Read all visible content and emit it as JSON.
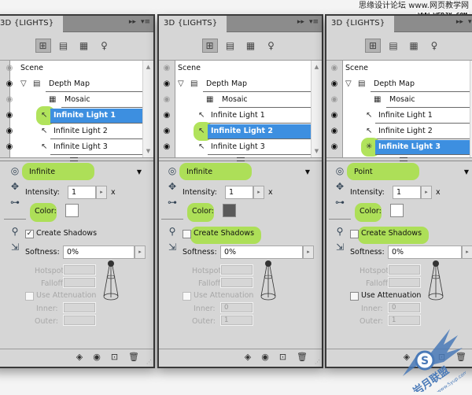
{
  "watermarks": {
    "top_line1": "思缘设计论坛 www.网页教学网",
    "top_line2": "WWW.WEBJX.COM",
    "bottom_text": "岩月联盟",
    "bottom_url": "www.5yup.com"
  },
  "panel_common": {
    "tab_title": "3D {LIGHTS}",
    "tab_controls": [
      "collapse-icon",
      "panel-menu-icon"
    ],
    "toolbar_buttons": [
      {
        "icon": "scene-filter-icon",
        "active": true
      },
      {
        "icon": "mesh-filter-icon",
        "active": false
      },
      {
        "icon": "material-filter-icon",
        "active": false
      },
      {
        "icon": "light-filter-icon",
        "active": false
      }
    ],
    "labels": {
      "intensity": "Intensity:",
      "multiply": "x",
      "color": "Color:",
      "create_shadows": "Create Shadows",
      "softness": "Softness:",
      "hotspot": "Hotspot:",
      "falloff": "Falloff:",
      "use_attenuation": "Use Attenuation",
      "inner": "Inner:",
      "outer": "Outer:"
    },
    "side_tools": [
      "rotate-light-icon",
      "pan-light-icon",
      "slide-light-icon",
      "point-at-origin-icon",
      "move-to-view-icon"
    ],
    "footer_icons": [
      "toggle-ground-plane-icon",
      "toggle-lights-icon",
      "new-light-icon",
      "delete-icon"
    ]
  },
  "panels": [
    {
      "scene_items": [
        {
          "label": "Scene",
          "icon": "none",
          "eye": "dim"
        },
        {
          "label": "Depth Map",
          "icon": "mesh-icon",
          "eye": "on",
          "expanded": true
        },
        {
          "label": "Mosaic",
          "icon": "material-icon",
          "eye": "dim"
        },
        {
          "label": "Infinite Light 1",
          "icon": "infinite-light-icon",
          "eye": "on"
        },
        {
          "label": "Infinite Light 2",
          "icon": "infinite-light-icon",
          "eye": "on"
        },
        {
          "label": "Infinite Light 3",
          "icon": "infinite-light-icon",
          "eye": "on"
        }
      ],
      "selected_index": 3,
      "light_type": "Infinite",
      "intensity": "1",
      "color": "#ffffff",
      "create_shadows": true,
      "softness": "0%",
      "hotspot": "",
      "falloff": "",
      "use_attenuation": false,
      "use_attenuation_enabled": false,
      "inner": "",
      "outer": "",
      "highlight_create_shadows": false
    },
    {
      "scene_items": [
        {
          "label": "Scene",
          "icon": "none",
          "eye": "dim"
        },
        {
          "label": "Depth Map",
          "icon": "mesh-icon",
          "eye": "on",
          "expanded": true
        },
        {
          "label": "Mosaic",
          "icon": "material-icon",
          "eye": "dim"
        },
        {
          "label": "Infinite Light 1",
          "icon": "infinite-light-icon",
          "eye": "on"
        },
        {
          "label": "Infinite Light 2",
          "icon": "infinite-light-icon",
          "eye": "on"
        },
        {
          "label": "Infinite Light 3",
          "icon": "infinite-light-icon",
          "eye": "on"
        }
      ],
      "selected_index": 4,
      "light_type": "Infinite",
      "intensity": "1",
      "color": "#5a5a5a",
      "create_shadows": false,
      "softness": "0%",
      "hotspot": "",
      "falloff": "",
      "use_attenuation": false,
      "use_attenuation_enabled": false,
      "inner": "0",
      "outer": "1",
      "highlight_create_shadows": true
    },
    {
      "scene_items": [
        {
          "label": "Scene",
          "icon": "none",
          "eye": "dim"
        },
        {
          "label": "Depth Map",
          "icon": "mesh-icon",
          "eye": "on",
          "expanded": true
        },
        {
          "label": "Mosaic",
          "icon": "material-icon",
          "eye": "dim"
        },
        {
          "label": "Infinite Light 1",
          "icon": "infinite-light-icon",
          "eye": "on"
        },
        {
          "label": "Infinite Light 2",
          "icon": "infinite-light-icon",
          "eye": "on"
        },
        {
          "label": "Infinite Light 3",
          "icon": "point-light-icon",
          "eye": "on"
        }
      ],
      "selected_index": 5,
      "light_type": "Point",
      "intensity": "1",
      "color": "#ffffff",
      "create_shadows": false,
      "softness": "0%",
      "hotspot": "",
      "falloff": "",
      "use_attenuation": false,
      "use_attenuation_enabled": true,
      "inner": "0",
      "outer": "1",
      "highlight_create_shadows": true
    }
  ],
  "colors": {
    "selection": "#3d8fe0",
    "highlight_marker": "#a8e04a",
    "panel_bg": "#d6d6d6"
  }
}
